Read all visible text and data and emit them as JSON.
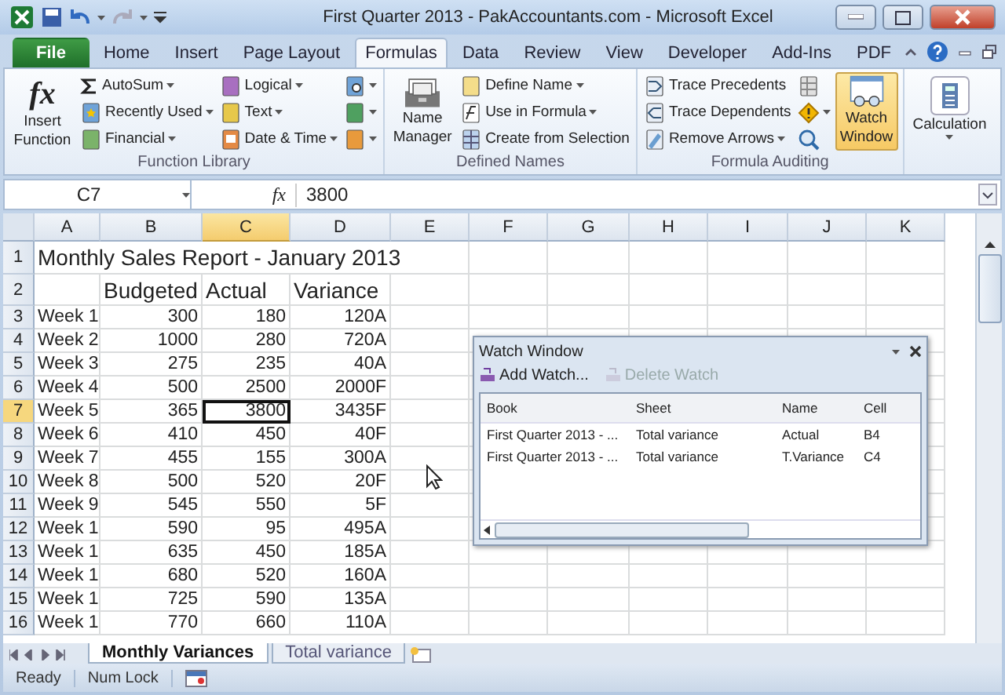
{
  "window": {
    "title": "First Quarter 2013 - PakAccountants.com - Microsoft Excel"
  },
  "tabs": [
    {
      "label": "File",
      "selected": false,
      "kind": "file"
    },
    {
      "label": "Home",
      "selected": false,
      "kind": "tab"
    },
    {
      "label": "Insert",
      "selected": false,
      "kind": "tab"
    },
    {
      "label": "Page Layout",
      "selected": false,
      "kind": "tab"
    },
    {
      "label": "Formulas",
      "selected": true,
      "kind": "tab"
    },
    {
      "label": "Data",
      "selected": false,
      "kind": "tab"
    },
    {
      "label": "Review",
      "selected": false,
      "kind": "tab"
    },
    {
      "label": "View",
      "selected": false,
      "kind": "tab"
    },
    {
      "label": "Developer",
      "selected": false,
      "kind": "tab"
    },
    {
      "label": "Add-Ins",
      "selected": false,
      "kind": "tab"
    },
    {
      "label": "PDF",
      "selected": false,
      "kind": "tab"
    }
  ],
  "ribbon": {
    "groups": [
      {
        "label": "Function Library",
        "big": [
          {
            "label": "Insert Function",
            "icon_text": "fx",
            "selected": false
          }
        ],
        "items": [
          {
            "kind": "labeled",
            "label": "AutoSum"
          },
          {
            "kind": "labeled",
            "label": "Recently Used"
          },
          {
            "kind": "labeled",
            "label": "Financial"
          },
          {
            "kind": "labeled",
            "label": "Logical"
          },
          {
            "kind": "labeled",
            "label": "Text"
          },
          {
            "kind": "labeled",
            "label": "Date & Time"
          },
          {
            "kind": "icon"
          },
          {
            "kind": "icon"
          },
          {
            "kind": "icon"
          }
        ]
      },
      {
        "label": "Defined Names",
        "big": [
          {
            "label": "Name Manager",
            "selected": false
          }
        ],
        "items": [
          {
            "kind": "labeled",
            "label": "Define Name"
          },
          {
            "kind": "labeled",
            "label": "Use in Formula"
          },
          {
            "kind": "labeled",
            "label": "Create from Selection"
          }
        ]
      },
      {
        "label": "Formula Auditing",
        "items": [
          {
            "kind": "labeled",
            "label": "Trace Precedents"
          },
          {
            "kind": "labeled",
            "label": "Trace Dependents"
          },
          {
            "kind": "labeled",
            "label": "Remove Arrows"
          },
          {
            "kind": "icon"
          },
          {
            "kind": "icon"
          },
          {
            "kind": "icon"
          }
        ],
        "after": [
          {
            "label": "Watch Window",
            "selected": true
          }
        ]
      },
      {
        "big": [
          {
            "label": "Calculation",
            "selected": false
          }
        ]
      }
    ]
  },
  "formula_bar": {
    "name_box": "C7",
    "fx": "fx",
    "value": "3800"
  },
  "columns": [
    {
      "label": "A",
      "selected": false
    },
    {
      "label": "B",
      "selected": false
    },
    {
      "label": "C",
      "selected": true
    },
    {
      "label": "D",
      "selected": false
    },
    {
      "label": "E",
      "selected": false
    },
    {
      "label": "F",
      "selected": false
    },
    {
      "label": "G",
      "selected": false
    },
    {
      "label": "H",
      "selected": false
    },
    {
      "label": "I",
      "selected": false
    },
    {
      "label": "J",
      "selected": false
    },
    {
      "label": "K",
      "selected": false
    }
  ],
  "rows": [
    {
      "header": "1",
      "selected": false,
      "kind": "title",
      "cells": [
        "Monthly Sales Report - January 2013"
      ]
    },
    {
      "header": "2",
      "selected": false,
      "kind": "heading",
      "cells": [
        "Budgeted",
        "Actual",
        "Variance"
      ]
    },
    {
      "header": "3",
      "selected": false,
      "kind": "data",
      "cells": [
        "Week 1",
        "300",
        "180",
        "120A"
      ]
    },
    {
      "header": "4",
      "selected": false,
      "kind": "data",
      "cells": [
        "Week 2",
        "1000",
        "280",
        "720A"
      ]
    },
    {
      "header": "5",
      "selected": false,
      "kind": "data",
      "cells": [
        "Week 3",
        "275",
        "235",
        "40A"
      ]
    },
    {
      "header": "6",
      "selected": false,
      "kind": "data",
      "cells": [
        "Week 4",
        "500",
        "2500",
        "2000F"
      ]
    },
    {
      "header": "7",
      "selected": true,
      "kind": "data",
      "cells": [
        "Week 5",
        "365",
        "3800",
        "3435F"
      ]
    },
    {
      "header": "8",
      "selected": false,
      "kind": "data",
      "cells": [
        "Week 6",
        "410",
        "450",
        "40F"
      ]
    },
    {
      "header": "9",
      "selected": false,
      "kind": "data",
      "cells": [
        "Week 7",
        "455",
        "155",
        "300A"
      ]
    },
    {
      "header": "10",
      "selected": false,
      "kind": "data",
      "cells": [
        "Week 8",
        "500",
        "520",
        "20F"
      ]
    },
    {
      "header": "11",
      "selected": false,
      "kind": "data",
      "cells": [
        "Week 9",
        "545",
        "550",
        "5F"
      ]
    },
    {
      "header": "12",
      "selected": false,
      "kind": "data",
      "cells": [
        "Week 1",
        "590",
        "95",
        "495A"
      ]
    },
    {
      "header": "13",
      "selected": false,
      "kind": "data",
      "cells": [
        "Week 1",
        "635",
        "450",
        "185A"
      ]
    },
    {
      "header": "14",
      "selected": false,
      "kind": "data",
      "cells": [
        "Week 1",
        "680",
        "520",
        "160A"
      ]
    },
    {
      "header": "15",
      "selected": false,
      "kind": "data",
      "cells": [
        "Week 1",
        "725",
        "590",
        "135A"
      ]
    },
    {
      "header": "16",
      "selected": false,
      "kind": "data",
      "cells": [
        "Week 1",
        "770",
        "660",
        "110A"
      ]
    }
  ],
  "watch_window": {
    "title": "Watch Window",
    "buttons": [
      {
        "label": "Add Watch...",
        "disabled": false
      },
      {
        "label": "Delete Watch",
        "disabled": true
      }
    ],
    "columns": [
      "Book",
      "Sheet",
      "Name",
      "Cell"
    ],
    "rows": [
      [
        "First Quarter 2013 - ...",
        "Total variance",
        "Actual",
        "B4"
      ],
      [
        "First Quarter 2013 - ...",
        "Total variance",
        "T.Variance",
        "C4"
      ]
    ]
  },
  "sheet_tabs": [
    {
      "label": "Monthly Variances",
      "selected": true
    },
    {
      "label": "Total variance",
      "selected": false
    }
  ],
  "status_bar": [
    "Ready",
    "Num Lock"
  ]
}
